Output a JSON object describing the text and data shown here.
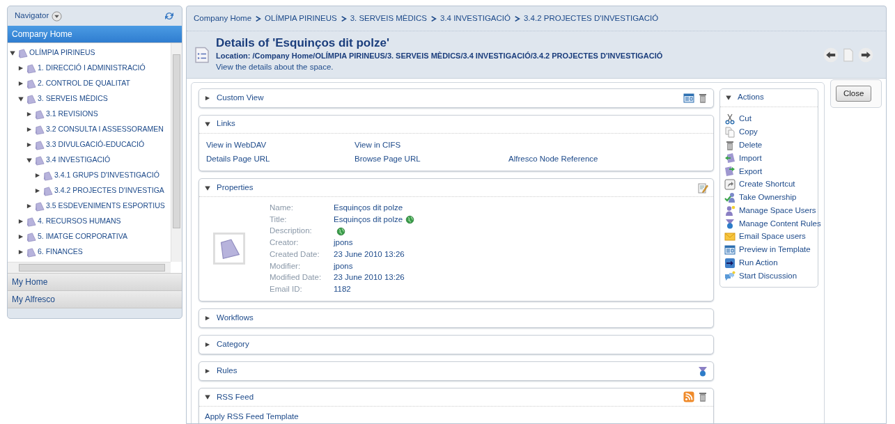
{
  "navigator": {
    "title": "Navigator",
    "items": [
      {
        "label": "Company Home",
        "selected": true
      },
      {
        "label": "My Home",
        "selected": false
      },
      {
        "label": "My Alfresco",
        "selected": false
      }
    ],
    "tree": [
      {
        "label": "OLÍMPIA PIRINEUS",
        "expanded": true,
        "children": [
          {
            "label": "1. DIRECCIÓ I ADMINISTRACIÓ",
            "expanded": false
          },
          {
            "label": "2. CONTROL DE QUALITAT",
            "expanded": false
          },
          {
            "label": "3. SERVEIS MÈDICS",
            "expanded": true,
            "children": [
              {
                "label": "3.1 REVISIONS",
                "expanded": false
              },
              {
                "label": "3.2 CONSULTA I ASSESSORAMEN",
                "expanded": false
              },
              {
                "label": "3.3 DIVULGACIÓ-EDUCACIÓ",
                "expanded": false
              },
              {
                "label": "3.4 INVESTIGACIÓ",
                "expanded": true,
                "children": [
                  {
                    "label": "3.4.1 GRUPS D'INVESTIGACIÓ",
                    "expanded": false
                  },
                  {
                    "label": "3.4.2 PROJECTES D'INVESTIGA",
                    "expanded": false
                  }
                ]
              },
              {
                "label": "3.5 ESDEVENIMENTS ESPORTIUS",
                "expanded": false
              }
            ]
          },
          {
            "label": "4. RECURSOS HUMANS",
            "expanded": false
          },
          {
            "label": "5. IMATGE CORPORATIVA",
            "expanded": false
          },
          {
            "label": "6. FINANCES",
            "expanded": false
          }
        ]
      }
    ]
  },
  "breadcrumb": [
    "Company Home",
    "OLÍMPIA PIRINEUS",
    "3. SERVEIS MÈDICS",
    "3.4 INVESTIGACIÓ",
    "3.4.2 PROJECTES D'INVESTIGACIÓ"
  ],
  "header": {
    "title": "Details of 'Esquinços dit polze'",
    "location": "Location: /Company Home/OLÍMPIA PIRINEUS/3. SERVEIS MÈDICS/3.4 INVESTIGACIÓ/3.4.2 PROJECTES D'INVESTIGACIÓ",
    "description": "View the details about the space."
  },
  "sections": [
    {
      "kind": "custom_view",
      "title": "Custom View",
      "expanded": false
    },
    {
      "kind": "links",
      "title": "Links",
      "expanded": true,
      "links": [
        [
          "View in WebDAV",
          "View in CIFS"
        ],
        [
          "Details Page URL",
          "Browse Page URL",
          "Alfresco Node Reference"
        ]
      ]
    },
    {
      "kind": "properties",
      "title": "Properties",
      "expanded": true,
      "properties": [
        {
          "label": "Name:",
          "value": "Esquinços dit polze",
          "globe": false
        },
        {
          "label": "Title:",
          "value": "Esquinços dit polze",
          "globe": true
        },
        {
          "label": "Description:",
          "globe": true
        },
        {
          "label": "Creator:",
          "value": "jpons",
          "globe": false
        },
        {
          "label": "Created Date:",
          "value": "23 June 2010 13:26",
          "globe": false
        },
        {
          "label": "Modifier:",
          "value": "jpons",
          "globe": false
        },
        {
          "label": "Modified Date:",
          "value": "23 June 2010 13:26",
          "globe": false
        },
        {
          "label": "Email ID:",
          "value": "1182",
          "globe": false
        }
      ]
    },
    {
      "kind": "workflows",
      "title": "Workflows",
      "expanded": false
    },
    {
      "kind": "category",
      "title": "Category",
      "expanded": false
    },
    {
      "kind": "rules",
      "title": "Rules",
      "expanded": false
    },
    {
      "kind": "rss",
      "title": "RSS Feed",
      "expanded": true,
      "links": [
        [
          "Apply RSS Feed Template"
        ]
      ]
    }
  ],
  "actions": {
    "title": "Actions",
    "expanded": true,
    "items": [
      "Cut",
      "Copy",
      "Delete",
      "Import",
      "Export",
      "Create Shortcut",
      "Take Ownership",
      "Manage Space Users",
      "Manage Content Rules",
      "Email Space users",
      "Preview in Template",
      "Run Action",
      "Start Discussion"
    ]
  },
  "close_button": "Close"
}
